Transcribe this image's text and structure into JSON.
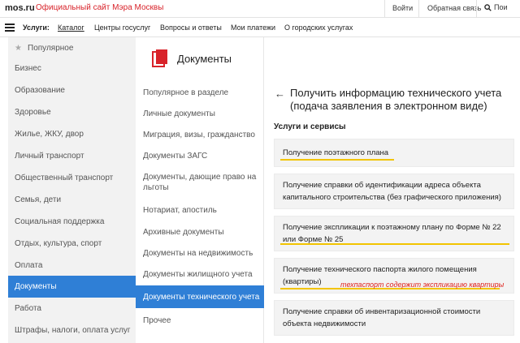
{
  "topbar": {
    "logo": "mos.ru",
    "site_title": "Официальный сайт Мэра Москвы",
    "login": "Войти",
    "feedback": "Обратная связь",
    "search": "Пои"
  },
  "navbar": {
    "label": "Услуги:",
    "items": [
      "Каталог",
      "Центры госуслуг",
      "Вопросы и ответы",
      "Мои платежи",
      "О городских услугах"
    ]
  },
  "sidebar": {
    "items": [
      {
        "label": "Популярное",
        "icon": "star-icon"
      },
      {
        "label": "Бизнес"
      },
      {
        "label": "Образование"
      },
      {
        "label": "Здоровье"
      },
      {
        "label": "Жилье, ЖКУ, двор"
      },
      {
        "label": "Личный транспорт"
      },
      {
        "label": "Общественный транспорт"
      },
      {
        "label": "Семья, дети"
      },
      {
        "label": "Социальная поддержка"
      },
      {
        "label": "Отдых, культура, спорт"
      },
      {
        "label": "Оплата"
      },
      {
        "label": "Документы"
      },
      {
        "label": "Работа"
      },
      {
        "label": "Штрафы, налоги, оплата услуг"
      }
    ],
    "active_index": 11
  },
  "documents": {
    "title": "Документы",
    "icon": "documents-icon",
    "accent_color": "#d8232a",
    "items": [
      "Популярное в разделе",
      "Личные документы",
      "Миграция, визы, гражданство",
      "Документы ЗАГС",
      "Документы, дающие право на льготы",
      "Нотариат, апостиль",
      "Архивные документы",
      "Документы на недвижимость",
      "Документы жилищного учета",
      "Документы технического учета",
      "Прочее"
    ],
    "active_index": 9
  },
  "content": {
    "back": "←",
    "title": "Получить информацию технического учета (подача заявления в электронном виде)",
    "services_label": "Услуги и сервисы",
    "cards": [
      "Получение поэтажного плана",
      "Получение справки об идентификации адреса объекта капитального строительства (без графического приложения)",
      "Получение экспликации к поэтажному плану по Форме № 22 или Форме № 25",
      "Получение технического паспорта жилого помещения (квартиры)",
      "Получение справки об инвентаризационной стоимости объекта недвижимости"
    ],
    "annotation": "техпаспорт содержит экспликацию квартиры",
    "highlight_color": "#f2c400",
    "annotation_color": "#e0201a",
    "active_color": "#2f7fd6"
  }
}
